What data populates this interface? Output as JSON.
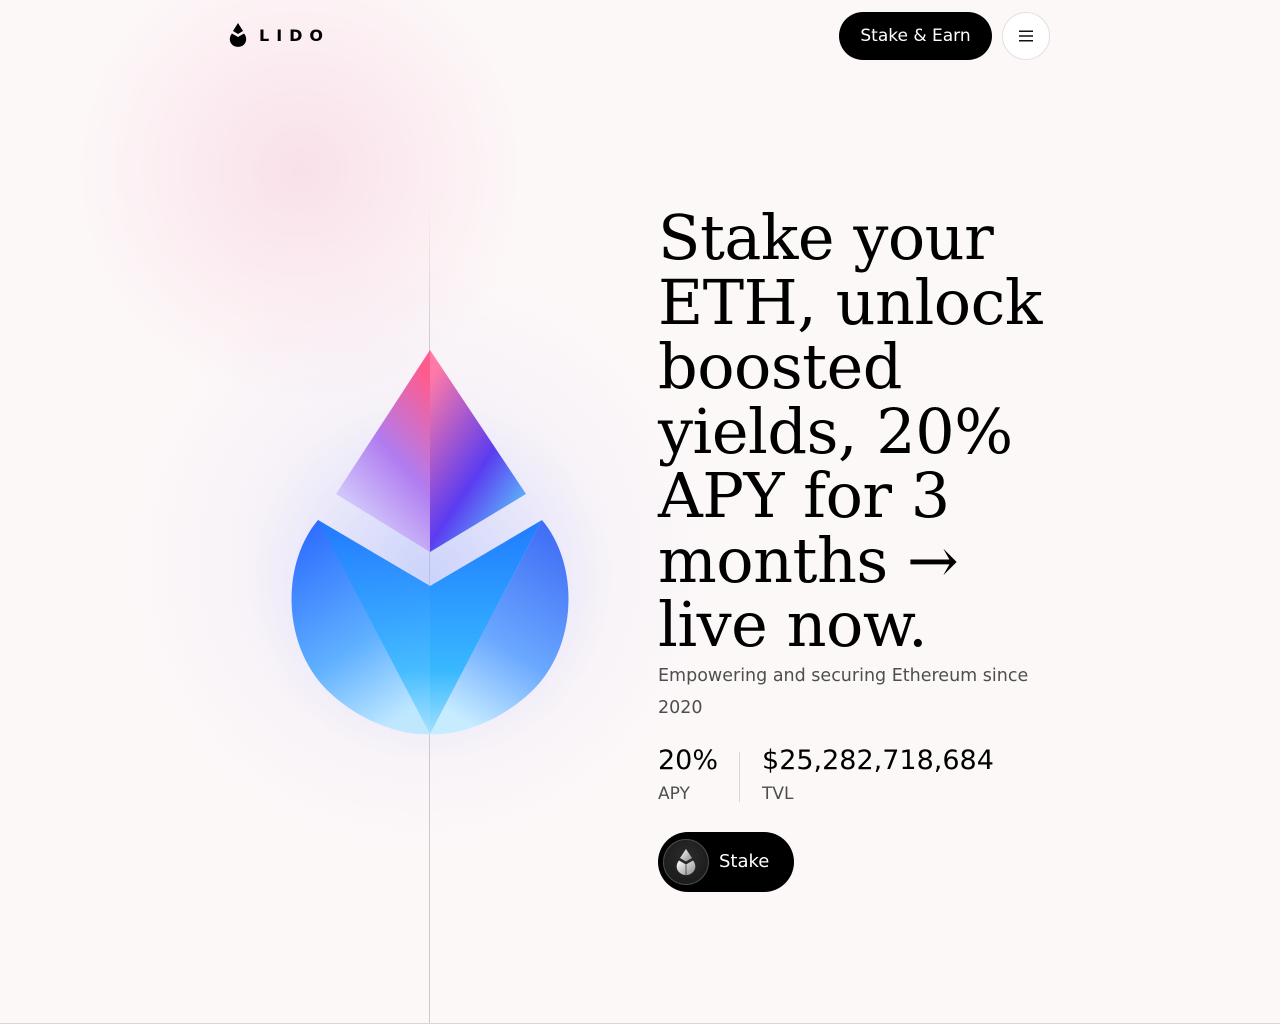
{
  "header": {
    "logo_text": "LIDO",
    "logo_icon": "lido-drop-icon",
    "cta_label": "Stake & Earn",
    "menu_icon": "hamburger-menu-icon"
  },
  "hero": {
    "illustration": "lido-drop-illustration",
    "colors": {
      "pink": "#ff6fa3",
      "violet": "#6b4cf5",
      "blue": "#1e6bff",
      "cyan": "#57d8ff",
      "light_blue": "#a9e2ff"
    },
    "headline": "Stake your ETH, unlock boosted yields, 20% APY for 3 months → live now.",
    "subtitle": "Empowering and securing Ethereum since 2020",
    "stats": [
      {
        "value": "20%",
        "label": "APY"
      },
      {
        "value": "$25,282,718,684",
        "label": "TVL"
      }
    ],
    "stake_button": {
      "label": "Stake",
      "icon": "steth-drop-icon"
    }
  },
  "colors": {
    "background": "#fdf8f8",
    "button": "#000000",
    "button_text": "#ffffff",
    "muted_text": "#4e4e4e"
  }
}
